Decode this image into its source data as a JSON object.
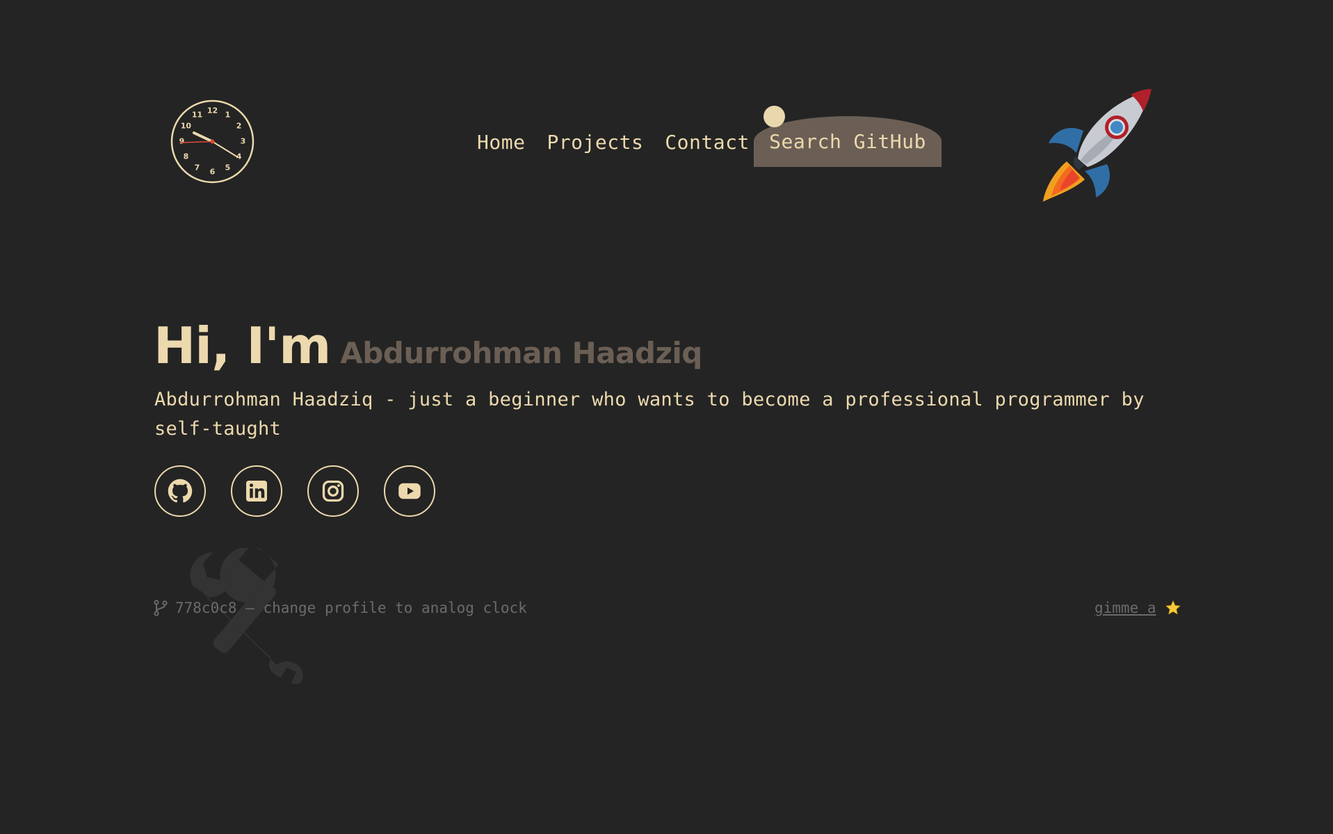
{
  "clock": {
    "numbers": [
      "12",
      "1",
      "2",
      "3",
      "4",
      "5",
      "6",
      "7",
      "8",
      "9",
      "10",
      "11"
    ],
    "hour_hand_color": "#ecd9ad",
    "second_hand_color": "#e04a3a"
  },
  "nav": {
    "items": [
      {
        "label": "Home"
      },
      {
        "label": "Projects"
      },
      {
        "label": "Contact"
      }
    ],
    "search_label": "Search GitHub",
    "search_bg": "#6b5f55"
  },
  "hero": {
    "greeting": "Hi, I'm",
    "name": "Abdurrohman Haadziq",
    "description": "Abdurrohman Haadziq - just a beginner who wants to become a professional programmer by self-taught"
  },
  "socials": [
    {
      "icon": "github-icon"
    },
    {
      "icon": "linkedin-icon"
    },
    {
      "icon": "instagram-icon"
    },
    {
      "icon": "youtube-icon"
    }
  ],
  "footer": {
    "commit_hash": "778c0c8",
    "commit_separator": " — ",
    "commit_message": "change profile to analog clock",
    "gimme_label": "gimme a",
    "star_icon": "star-icon"
  },
  "colors": {
    "background": "#242424",
    "accent": "#ecd9ad",
    "muted": "#6b5f55"
  }
}
